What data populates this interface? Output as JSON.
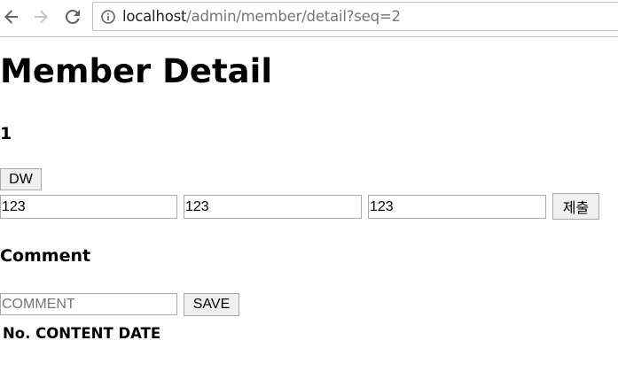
{
  "browser": {
    "url_host": "localhost",
    "url_path": "/admin/member/detail?seq=2",
    "icons": [
      "back-arrow-icon",
      "forward-arrow-icon",
      "reload-icon",
      "info-icon"
    ]
  },
  "page": {
    "title": "Member Detail",
    "member_number": "1",
    "dw_button_label": "DW",
    "inputs": [
      "123",
      "123",
      "123"
    ],
    "submit_label": "제출",
    "comment_heading": "Comment",
    "comment_placeholder": "COMMENT",
    "comment_value": "",
    "save_label": "SAVE",
    "table_headers": [
      "No.",
      "CONTENT",
      "DATE"
    ]
  }
}
